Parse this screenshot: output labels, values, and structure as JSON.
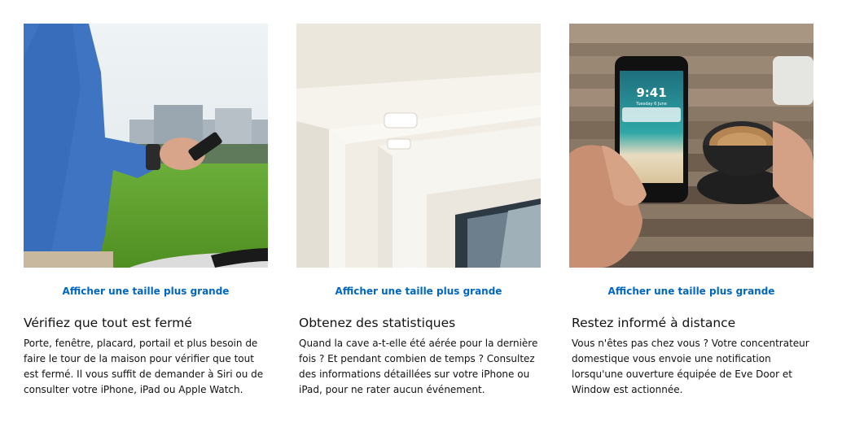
{
  "features": [
    {
      "image_alt": "Homme à vélo regardant son téléphone",
      "enlarge_link": "Afficher une taille plus grande",
      "title": "Vérifiez que tout est fermé",
      "description": "Porte, fenêtre, placard, portail et plus besoin de faire le tour de la maison pour vérifier que tout est fermé. Il vous suffit de demander à Siri ou de consulter votre iPhone, iPad ou Apple Watch."
    },
    {
      "image_alt": "Capteur Eve Door and Window installé sur une fenêtre",
      "enlarge_link": "Afficher une taille plus grande",
      "title": "Obtenez des statistiques",
      "description": "Quand la cave a-t-elle été aérée pour la dernière fois ? Et pendant combien de temps ? Consultez des informations détaillées sur votre iPhone ou iPad, pour ne rater aucun événement."
    },
    {
      "image_alt": "iPhone affichant une notification à côté d'une tasse de café",
      "enlarge_link": "Afficher une taille plus grande",
      "title": "Restez informé à distance",
      "description": "Vous n'êtes pas chez vous ? Votre concentrateur domestique vous envoie une notification lorsqu'une ouverture équipée de Eve Door et Window est actionnée.",
      "phone_time": "9:41",
      "phone_date": "Tuesday 6 June"
    }
  ],
  "colors": {
    "link": "#0066c0",
    "text": "#111111"
  }
}
